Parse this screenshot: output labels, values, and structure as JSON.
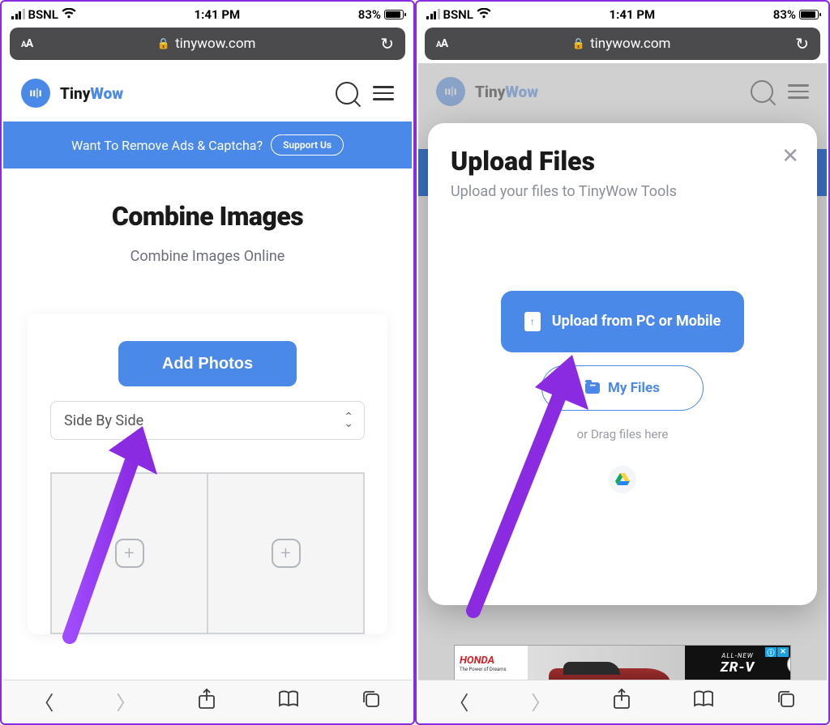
{
  "status": {
    "carrier": "BSNL",
    "time": "1:41 PM",
    "battery_pct": "83%"
  },
  "safari": {
    "domain": "tinywow.com"
  },
  "brand": {
    "name_a": "Tiny",
    "name_b": "Wow"
  },
  "banner": {
    "text": "Want To Remove Ads & Captcha?",
    "cta": "Support Us"
  },
  "page": {
    "title": "Combine Images",
    "subtitle": "Combine Images Online"
  },
  "card": {
    "add_btn": "Add Photos",
    "select_value": "Side By Side"
  },
  "modal": {
    "title": "Upload Files",
    "subtitle": "Upload your files to TinyWow Tools",
    "upload_btn": "Upload from PC or Mobile",
    "myfiles": "My Files",
    "drag": "or Drag files here"
  },
  "ad": {
    "brand": "HONDA",
    "tagline": "The Power of Dreams",
    "badge": "ALL-NEW",
    "model": "ZR-V"
  }
}
